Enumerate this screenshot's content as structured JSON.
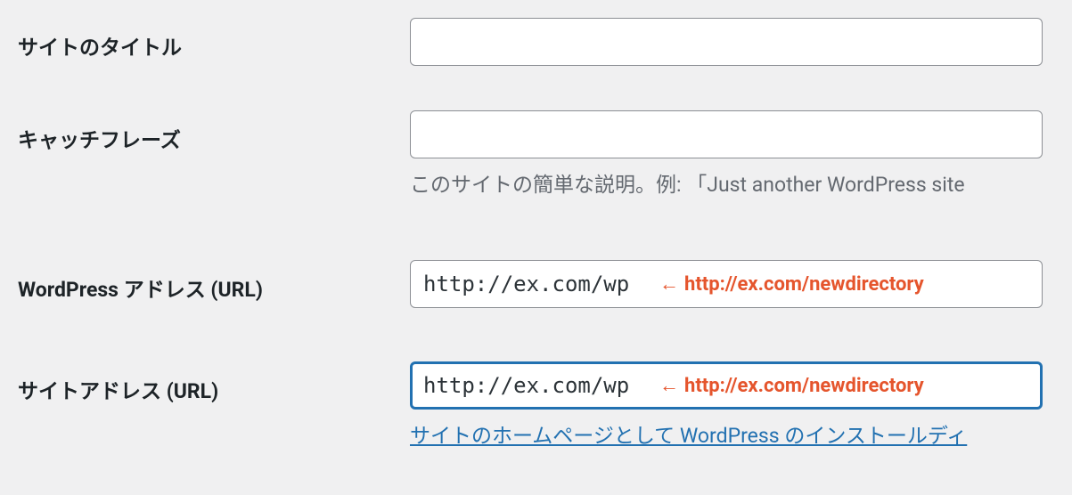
{
  "rows": {
    "site_title": {
      "label": "サイトのタイトル",
      "value": ""
    },
    "tagline": {
      "label": "キャッチフレーズ",
      "value": "",
      "description": "このサイトの簡単な説明。例: 「Just another WordPress site"
    },
    "wp_url": {
      "label": "WordPress アドレス (URL)",
      "value": "http://ex.com/wp",
      "annotation_arrow": "←",
      "annotation_text": "http://ex.com/newdirectory"
    },
    "site_url": {
      "label": "サイトアドレス (URL)",
      "value": "http://ex.com/wp",
      "annotation_arrow": "←",
      "annotation_text": "http://ex.com/newdirectory",
      "helper_link": "サイトのホームページとして WordPress のインストールディ"
    }
  }
}
